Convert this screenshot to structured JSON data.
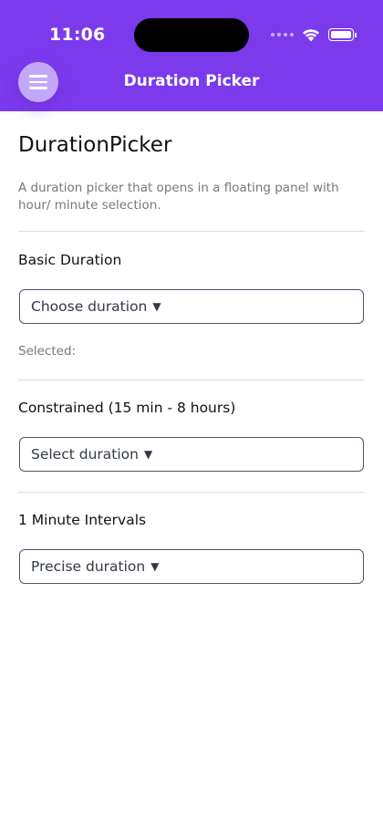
{
  "status": {
    "time": "11:06"
  },
  "header": {
    "title": "Duration Picker",
    "menu_icon": "hamburger-menu-icon",
    "accent": "#7c3aed"
  },
  "page": {
    "title": "DurationPicker",
    "description": "A duration picker that opens in a floating panel with hour/ minute selection."
  },
  "sections": [
    {
      "label": "Basic Duration",
      "button": "Choose duration",
      "caret": "▼",
      "selected_label": "Selected:"
    },
    {
      "label": "Constrained (15 min - 8 hours)",
      "button": "Select duration",
      "caret": "▼"
    },
    {
      "label": "1 Minute Intervals",
      "button": "Precise duration",
      "caret": "▼"
    }
  ]
}
